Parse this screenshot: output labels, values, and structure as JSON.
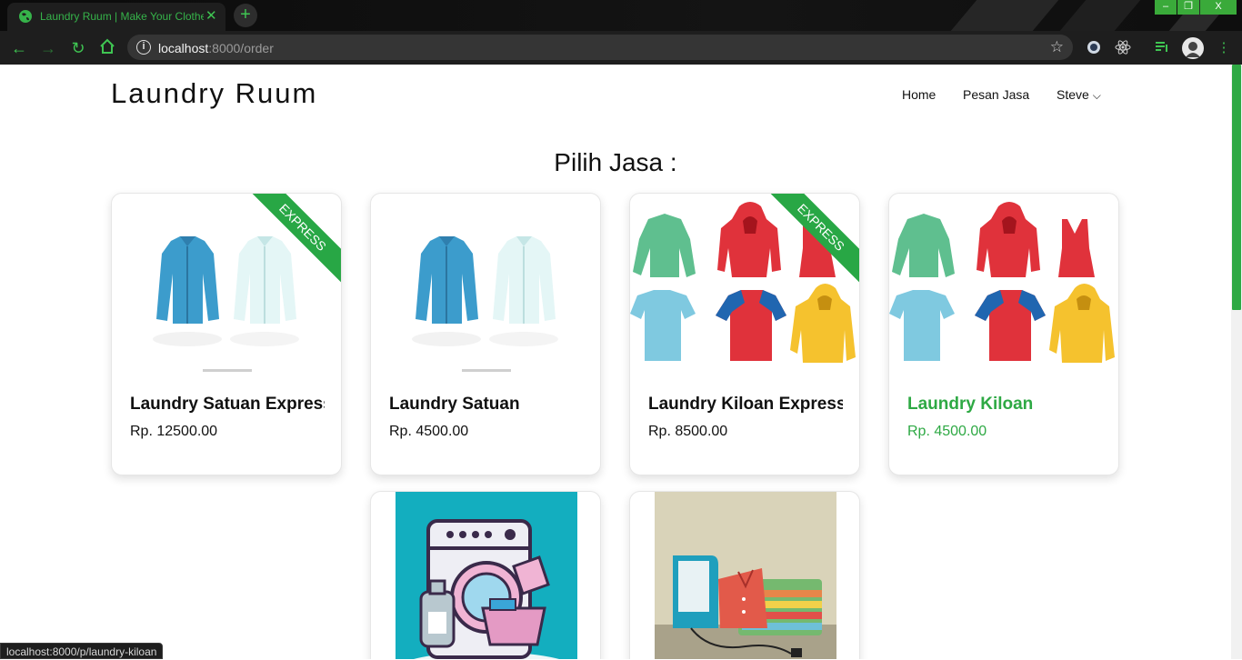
{
  "browser": {
    "tab_title": "Laundry Ruum | Make Your Clothes",
    "tab_close": "✕",
    "new_tab": "+",
    "url_host": "localhost",
    "url_rest": ":8000/order",
    "window_controls": [
      "–",
      "❐",
      "X"
    ],
    "status_url": "localhost:8000/p/laundry-kiloan"
  },
  "navbar": {
    "brand": "Laundry Ruum",
    "links": [
      "Home",
      "Pesan Jasa",
      "Steve"
    ],
    "user_caret": "⌄"
  },
  "main": {
    "heading": "Pilih Jasa :",
    "services": [
      {
        "name": "Laundry Satuan Express",
        "price": "Rp. 12500.00",
        "badge": "EXPRESS",
        "image": "shirts"
      },
      {
        "name": "Laundry Satuan",
        "price": "Rp. 4500.00",
        "badge": "",
        "image": "shirts"
      },
      {
        "name": "Laundry Kiloan Express",
        "price": "Rp. 8500.00",
        "badge": "EXPRESS",
        "image": "clothes"
      },
      {
        "name": "Laundry Kiloan",
        "price": "Rp. 4500.00",
        "badge": "",
        "image": "clothes"
      }
    ],
    "extra_cards": [
      {
        "image": "washing-machine"
      },
      {
        "image": "ironing"
      }
    ]
  },
  "colors": {
    "accent": "#2ea944",
    "chrome_bg": "#1e1e1e",
    "ribbon": "#28a745"
  }
}
